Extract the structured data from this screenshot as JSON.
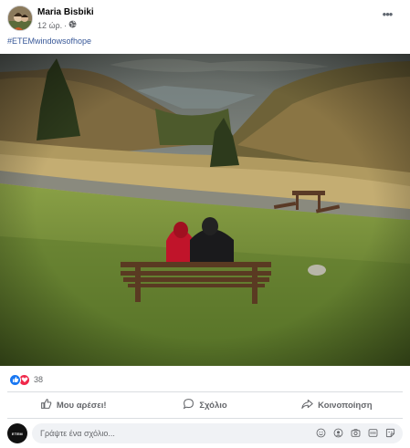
{
  "post": {
    "author": "Maria Bisbiki",
    "time": "12 ώρ.",
    "separator": "·",
    "hashtag": "#ETEMwindowsofhope",
    "more_label": "•••"
  },
  "reactions": {
    "count": "38",
    "types": [
      "like-icon",
      "love-icon"
    ],
    "colors": {
      "like": "#1877f2",
      "love": "#f0284a"
    }
  },
  "actions": {
    "like": "Μου αρέσει!",
    "comment": "Σχόλιο",
    "share": "Κοινοποίηση"
  },
  "comment_box": {
    "placeholder": "Γράψτε ένα σχόλιο...",
    "avatar_text": "ETEM",
    "icons": [
      "emoji-icon",
      "avatar-sticker-icon",
      "camera-icon",
      "gif-icon",
      "sticker-icon"
    ]
  },
  "colors": {
    "link": "#385898",
    "secondary_text": "#65676b",
    "divider": "#dadde1"
  }
}
